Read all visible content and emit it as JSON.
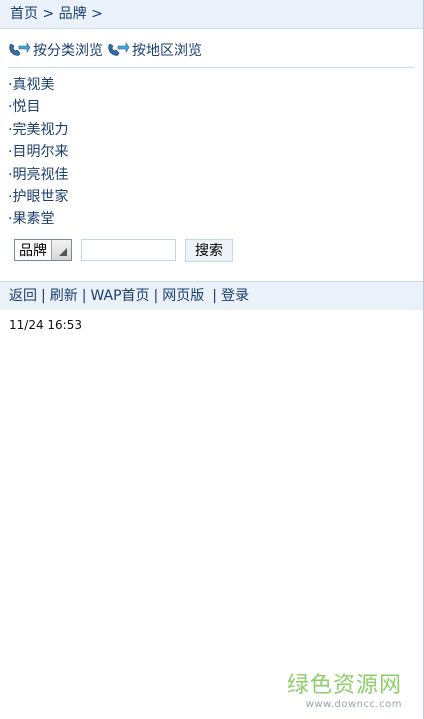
{
  "breadcrumb": {
    "home": "首页",
    "sep1": " > ",
    "current": "品牌",
    "sep2": " >"
  },
  "browse": {
    "by_category": "按分类浏览",
    "by_region": "按地区浏览",
    "icon": "phone-arrow-icon"
  },
  "brands": [
    "真视美",
    "悦目",
    "完美视力",
    "目明尔来",
    "明亮视佳",
    "护眼世家",
    "果素堂"
  ],
  "brand_bullet": "·",
  "search": {
    "select_value": "品牌",
    "input_value": "",
    "button_label": "搜索"
  },
  "bottom_nav": {
    "back": "返回",
    "refresh": "刷新",
    "wap_home": "WAP首页",
    "web_version": "网页版",
    "login": "登录"
  },
  "timestamp": "11/24 16:53",
  "watermark": {
    "cn": "绿色资源网",
    "en": "www.downcc.com"
  },
  "colors": {
    "link": "#1b3f6e",
    "bar_bg": "#eaf1f9",
    "watermark_green": "#8ccf6a"
  }
}
